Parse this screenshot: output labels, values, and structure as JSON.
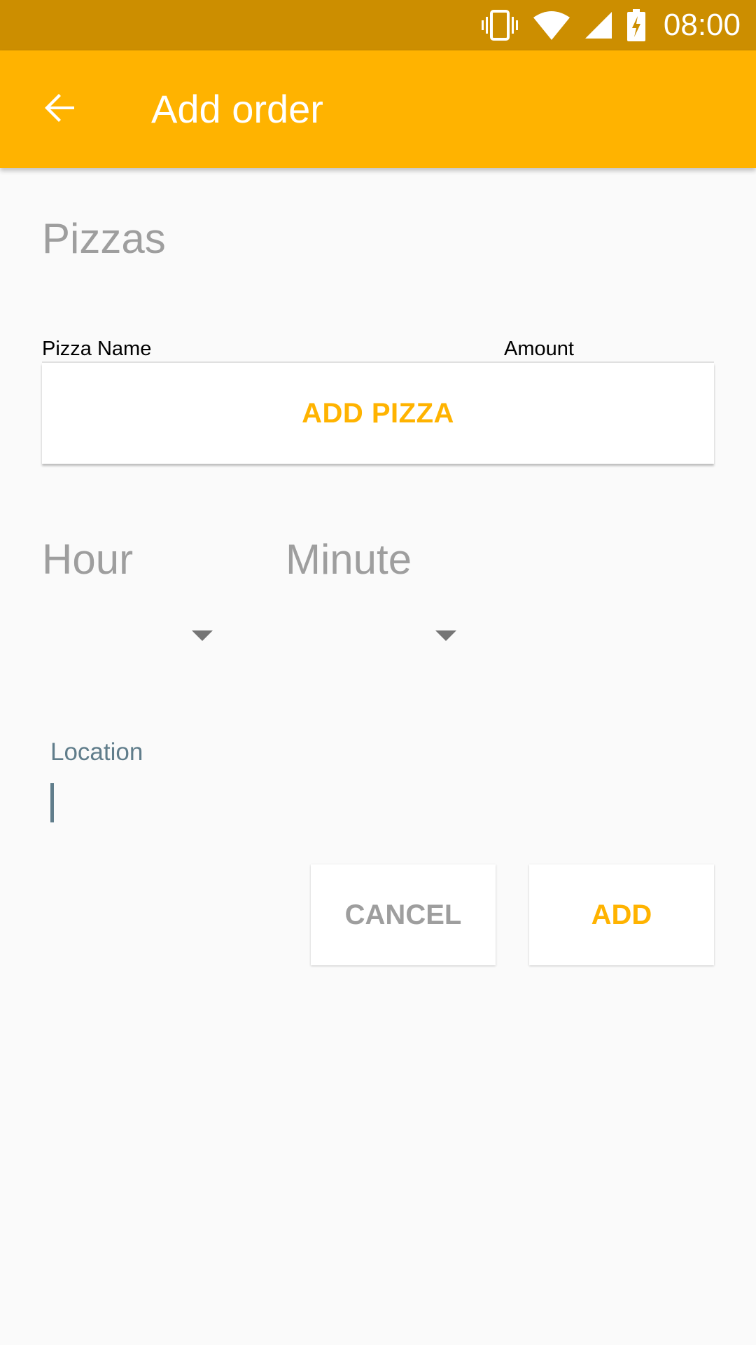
{
  "status_bar": {
    "time": "08:00",
    "icons": [
      "vibrate-icon",
      "wifi-icon",
      "signal-icon",
      "battery-charging-icon"
    ]
  },
  "app_bar": {
    "back_icon": "arrow-back-icon",
    "title": "Add order"
  },
  "pizzas": {
    "section_title": "Pizzas",
    "columns": [
      "Pizza Name",
      "Amount"
    ],
    "add_button": "ADD PIZZA"
  },
  "time": {
    "hour_label": "Hour",
    "minute_label": "Minute"
  },
  "location": {
    "label": "Location",
    "value": ""
  },
  "actions": {
    "cancel": "CANCEL",
    "add": "ADD"
  },
  "colors": {
    "status_bar": "#cc8e00",
    "accent": "#ffb300",
    "muted_text": "#9e9e9e",
    "input_label": "#607d8b"
  }
}
